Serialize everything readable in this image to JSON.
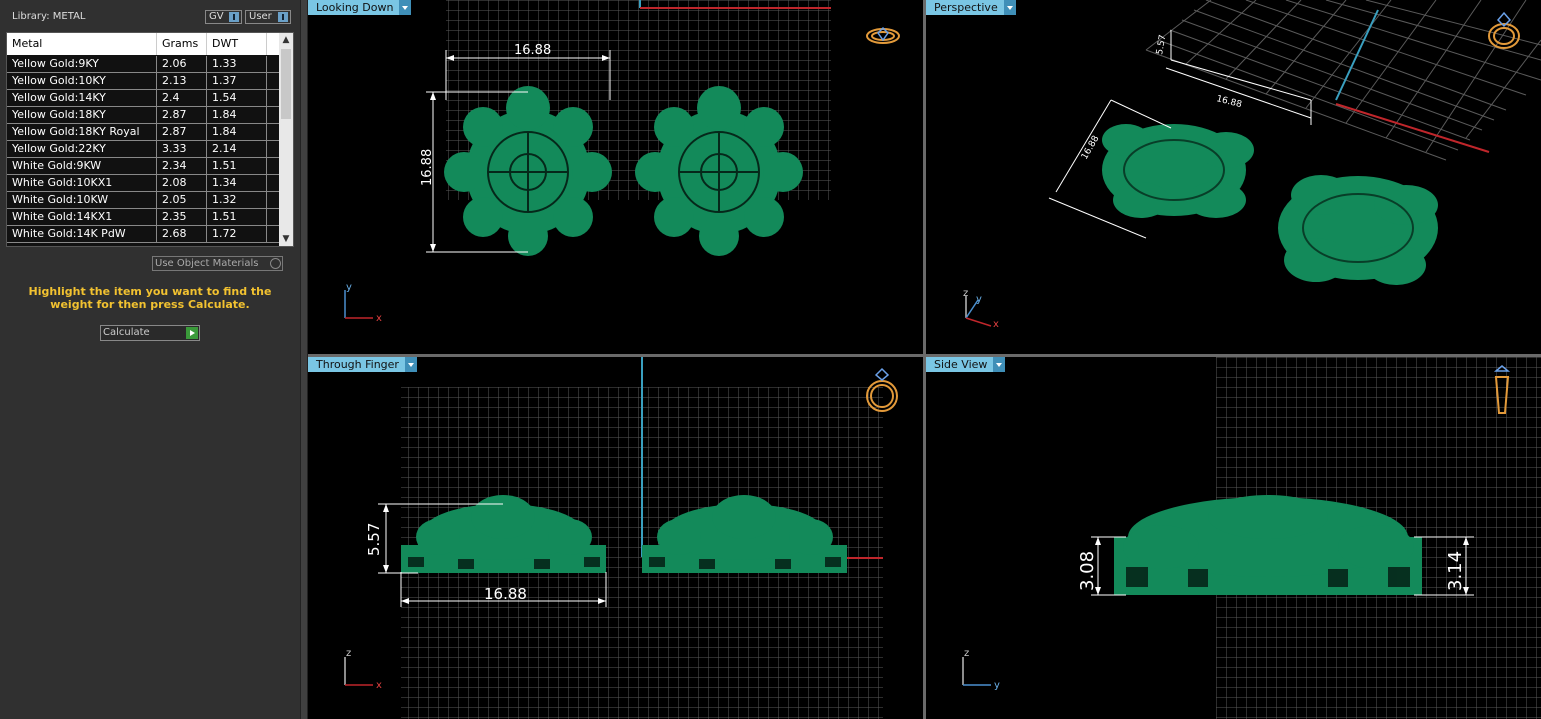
{
  "library": {
    "title": "Library: METAL",
    "gv_label": "GV",
    "user_label": "User"
  },
  "table": {
    "headers": [
      "Metal",
      "Grams",
      "DWT"
    ],
    "rows": [
      [
        "Yellow Gold:9KY",
        "2.06",
        "1.33"
      ],
      [
        "Yellow Gold:10KY",
        "2.13",
        "1.37"
      ],
      [
        "Yellow Gold:14KY",
        "2.4",
        "1.54"
      ],
      [
        "Yellow Gold:18KY",
        "2.87",
        "1.84"
      ],
      [
        "Yellow Gold:18KY Royal",
        "2.87",
        "1.84"
      ],
      [
        "Yellow Gold:22KY",
        "3.33",
        "2.14"
      ],
      [
        "White Gold:9KW",
        "2.34",
        "1.51"
      ],
      [
        "White Gold:10KX1",
        "2.08",
        "1.34"
      ],
      [
        "White Gold:10KW",
        "2.05",
        "1.32"
      ],
      [
        "White Gold:14KX1",
        "2.35",
        "1.51"
      ],
      [
        "White Gold:14K PdW",
        "2.68",
        "1.72"
      ]
    ]
  },
  "use_object_label": "Use Object Materials",
  "instructions": "Highlight the item you want to find the weight for then press Calculate.",
  "calculate_label": "Calculate",
  "viewports": {
    "top": {
      "label": "Looking Down",
      "dim_width": "16.88",
      "dim_height": "16.88",
      "axis_y": "y",
      "axis_x": "x"
    },
    "perspective": {
      "label": "Perspective",
      "dim_a": "16.88",
      "dim_b": "16.88",
      "dim_c": "5.57",
      "axis_z": "z",
      "axis_y": "y",
      "axis_x": "x"
    },
    "front": {
      "label": "Through Finger",
      "dim_width": "16.88",
      "dim_height": "5.57",
      "axis_z": "z",
      "axis_x": "x"
    },
    "side": {
      "label": "Side View",
      "dim_left": "3.08",
      "dim_right": "3.14",
      "axis_z": "z",
      "axis_y": "y"
    }
  },
  "colors": {
    "model": "#138a5a",
    "grid": "#5a5a5a",
    "accent": "#7ac6e4",
    "red_axis": "#c0262b",
    "blue_axis": "#3aa0c0",
    "highlight": "#f2c230"
  },
  "icons": [
    "ring-gem-icon",
    "dropdown-arrow-icon",
    "play-icon"
  ]
}
